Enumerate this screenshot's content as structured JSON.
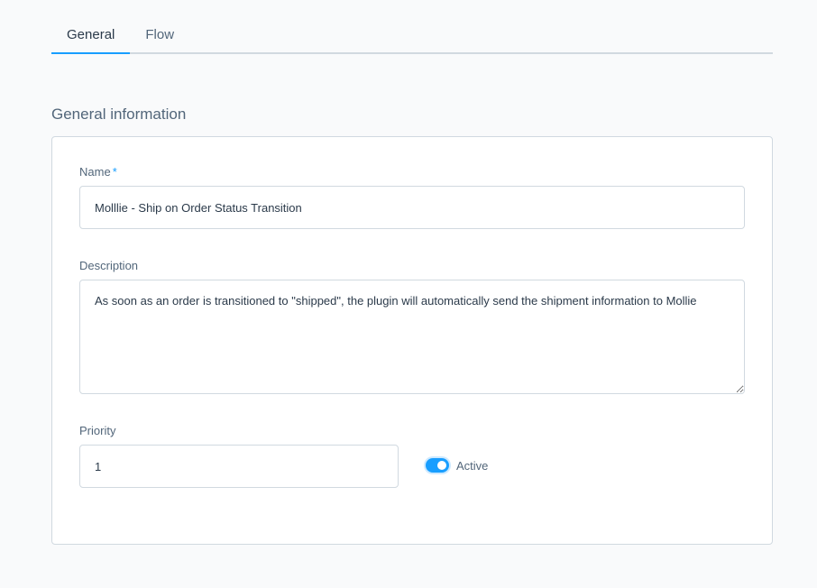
{
  "tabs": [
    {
      "label": "General",
      "active": true
    },
    {
      "label": "Flow",
      "active": false
    }
  ],
  "section": {
    "title": "General information"
  },
  "form": {
    "name": {
      "label": "Name",
      "required_mark": "*",
      "value": "Molllie - Ship on Order Status Transition"
    },
    "description": {
      "label": "Description",
      "value": "As soon as an order is transitioned to \"shipped\", the plugin will automatically send the shipment information to Mollie"
    },
    "priority": {
      "label": "Priority",
      "value": "1"
    },
    "active": {
      "label": "Active",
      "checked": true
    }
  },
  "colors": {
    "accent": "#189eff",
    "border": "#d1d9e0",
    "text": "#52667a",
    "background": "#f9fafb"
  }
}
